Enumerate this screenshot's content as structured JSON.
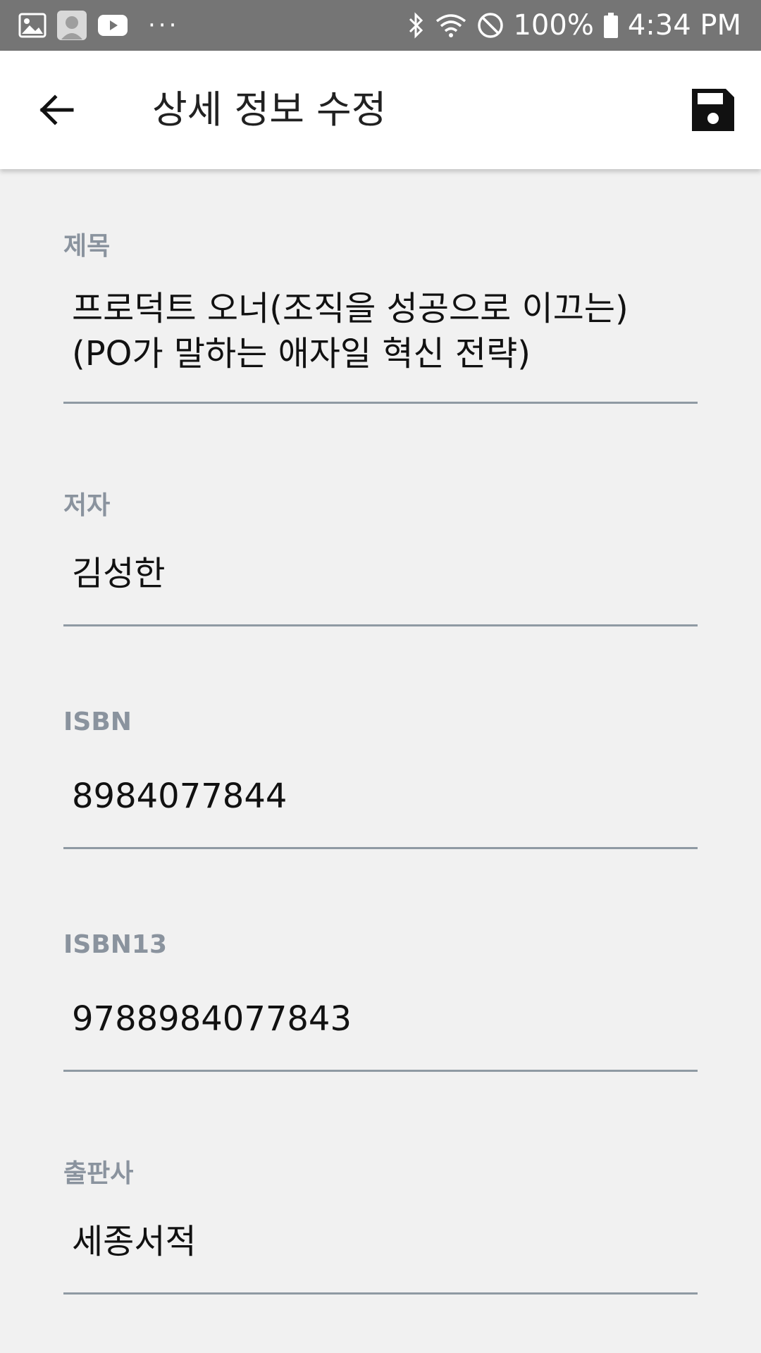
{
  "status_bar": {
    "icons_left": [
      "image-icon",
      "avatar-icon",
      "youtube-icon"
    ],
    "overflow": "···",
    "battery": "100%",
    "time": "4:34 PM"
  },
  "app_bar": {
    "title": "상세 정보 수정",
    "back_icon": "arrow-back-icon",
    "save_icon": "save-icon"
  },
  "fields": [
    {
      "label": "제목",
      "value": "프로덕트 오너(조직을 성공으로 이끄는)\n(PO가 말하는 애자일 혁신 전략)"
    },
    {
      "label": "저자",
      "value": "김성한"
    },
    {
      "label": "ISBN",
      "value": "8984077844"
    },
    {
      "label": "ISBN13",
      "value": "9788984077843"
    },
    {
      "label": "출판사",
      "value": "세종서적"
    }
  ]
}
